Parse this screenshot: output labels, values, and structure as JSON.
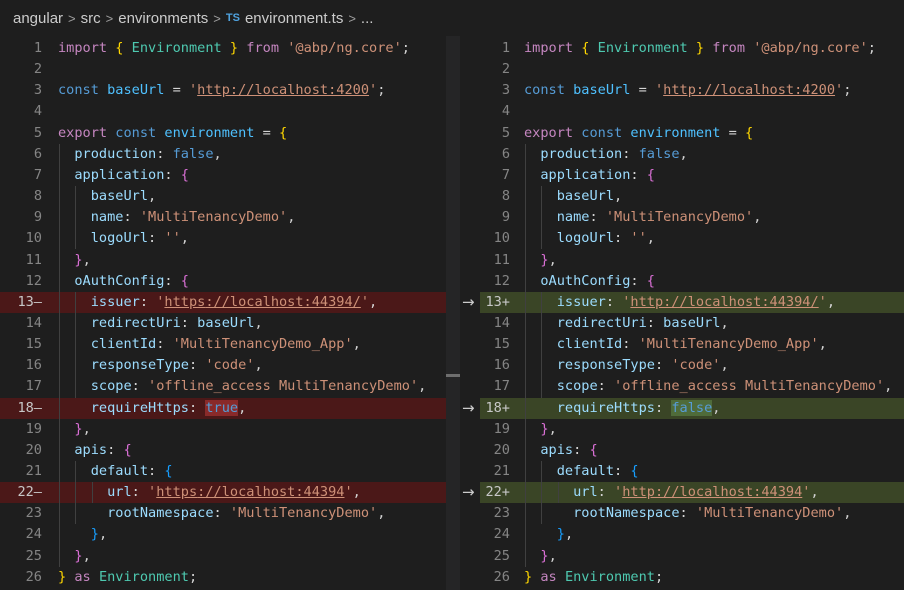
{
  "breadcrumb": {
    "items": [
      "angular",
      "src",
      "environments"
    ],
    "file_badge": "TS",
    "file": "environment.ts",
    "more": "..."
  },
  "left_lines": [
    {
      "n": "1",
      "t": [
        [
          "kb-import",
          "import"
        ],
        [
          "p",
          " "
        ],
        [
          "b1",
          "{"
        ],
        [
          "p",
          " "
        ],
        [
          "t",
          "Environment"
        ],
        [
          "p",
          " "
        ],
        [
          "b1",
          "}"
        ],
        [
          "p",
          " "
        ],
        [
          "k",
          "from"
        ],
        [
          "p",
          " "
        ],
        [
          "s",
          "'@abp/ng.core'"
        ],
        [
          "d",
          ";"
        ]
      ]
    },
    {
      "n": "2",
      "t": []
    },
    {
      "n": "3",
      "t": [
        [
          "kb",
          "const"
        ],
        [
          "d",
          " "
        ],
        [
          "v",
          "baseUrl"
        ],
        [
          "d",
          " = "
        ],
        [
          "s",
          "'"
        ],
        [
          "u",
          "http://localhost:4200"
        ],
        [
          "s",
          "'"
        ],
        [
          "d",
          ";"
        ]
      ]
    },
    {
      "n": "4",
      "t": []
    },
    {
      "n": "5",
      "t": [
        [
          "k",
          "export"
        ],
        [
          "d",
          " "
        ],
        [
          "kb",
          "const"
        ],
        [
          "d",
          " "
        ],
        [
          "v",
          "environment"
        ],
        [
          "d",
          " = "
        ],
        [
          "b1",
          "{"
        ]
      ]
    },
    {
      "n": "6",
      "t": [
        [
          "d",
          "  "
        ],
        [
          "p",
          "production"
        ],
        [
          "d",
          ": "
        ],
        [
          "kb",
          "false"
        ],
        [
          "d",
          ","
        ]
      ]
    },
    {
      "n": "7",
      "t": [
        [
          "d",
          "  "
        ],
        [
          "p",
          "application"
        ],
        [
          "d",
          ": "
        ],
        [
          "b2",
          "{"
        ]
      ]
    },
    {
      "n": "8",
      "t": [
        [
          "d",
          "    "
        ],
        [
          "p",
          "baseUrl"
        ],
        [
          "d",
          ","
        ]
      ]
    },
    {
      "n": "9",
      "t": [
        [
          "d",
          "    "
        ],
        [
          "p",
          "name"
        ],
        [
          "d",
          ": "
        ],
        [
          "s",
          "'MultiTenancyDemo'"
        ],
        [
          "d",
          ","
        ]
      ]
    },
    {
      "n": "10",
      "t": [
        [
          "d",
          "    "
        ],
        [
          "p",
          "logoUrl"
        ],
        [
          "d",
          ": "
        ],
        [
          "s",
          "''"
        ],
        [
          "d",
          ","
        ]
      ]
    },
    {
      "n": "11",
      "t": [
        [
          "d",
          "  "
        ],
        [
          "b2",
          "}"
        ],
        [
          "d",
          ","
        ]
      ]
    },
    {
      "n": "12",
      "t": [
        [
          "d",
          "  "
        ],
        [
          "p",
          "oAuthConfig"
        ],
        [
          "d",
          ": "
        ],
        [
          "b2",
          "{"
        ]
      ]
    },
    {
      "n": "13—",
      "cls": "del",
      "t": [
        [
          "d",
          "    "
        ],
        [
          "p",
          "issuer"
        ],
        [
          "d",
          ": "
        ],
        [
          "s",
          "'"
        ],
        [
          "u",
          "https"
        ],
        [
          "u",
          "://localhost:44394/"
        ],
        [
          "s",
          "'"
        ],
        [
          "d",
          ","
        ]
      ]
    },
    {
      "n": "14",
      "t": [
        [
          "d",
          "    "
        ],
        [
          "p",
          "redirectUri"
        ],
        [
          "d",
          ": "
        ],
        [
          "p",
          "baseUrl"
        ],
        [
          "d",
          ","
        ]
      ]
    },
    {
      "n": "15",
      "t": [
        [
          "d",
          "    "
        ],
        [
          "p",
          "clientId"
        ],
        [
          "d",
          ": "
        ],
        [
          "s",
          "'MultiTenancyDemo_App'"
        ],
        [
          "d",
          ","
        ]
      ]
    },
    {
      "n": "16",
      "t": [
        [
          "d",
          "    "
        ],
        [
          "p",
          "responseType"
        ],
        [
          "d",
          ": "
        ],
        [
          "s",
          "'code'"
        ],
        [
          "d",
          ","
        ]
      ]
    },
    {
      "n": "17",
      "t": [
        [
          "d",
          "    "
        ],
        [
          "p",
          "scope"
        ],
        [
          "d",
          ": "
        ],
        [
          "s",
          "'offline_access MultiTenancyDemo'"
        ],
        [
          "d",
          ","
        ]
      ]
    },
    {
      "n": "18—",
      "cls": "del",
      "t": [
        [
          "d",
          "    "
        ],
        [
          "p",
          "requireHttps"
        ],
        [
          "d",
          ": "
        ],
        [
          "kbw",
          "true"
        ],
        [
          "d",
          ","
        ]
      ]
    },
    {
      "n": "19",
      "t": [
        [
          "d",
          "  "
        ],
        [
          "b2",
          "}"
        ],
        [
          "d",
          ","
        ]
      ]
    },
    {
      "n": "20",
      "t": [
        [
          "d",
          "  "
        ],
        [
          "p",
          "apis"
        ],
        [
          "d",
          ": "
        ],
        [
          "b2",
          "{"
        ]
      ]
    },
    {
      "n": "21",
      "t": [
        [
          "d",
          "    "
        ],
        [
          "p",
          "default"
        ],
        [
          "d",
          ": "
        ],
        [
          "b3",
          "{"
        ]
      ]
    },
    {
      "n": "22—",
      "cls": "del",
      "t": [
        [
          "d",
          "      "
        ],
        [
          "p",
          "url"
        ],
        [
          "d",
          ": "
        ],
        [
          "s",
          "'"
        ],
        [
          "u",
          "https"
        ],
        [
          "u",
          "://localhost:44394"
        ],
        [
          "s",
          "'"
        ],
        [
          "d",
          ","
        ]
      ]
    },
    {
      "n": "23",
      "t": [
        [
          "d",
          "      "
        ],
        [
          "p",
          "rootNamespace"
        ],
        [
          "d",
          ": "
        ],
        [
          "s",
          "'MultiTenancyDemo'"
        ],
        [
          "d",
          ","
        ]
      ]
    },
    {
      "n": "24",
      "t": [
        [
          "d",
          "    "
        ],
        [
          "b3",
          "}"
        ],
        [
          "d",
          ","
        ]
      ]
    },
    {
      "n": "25",
      "t": [
        [
          "d",
          "  "
        ],
        [
          "b2",
          "}"
        ],
        [
          "d",
          ","
        ]
      ]
    },
    {
      "n": "26",
      "t": [
        [
          "b1",
          "}"
        ],
        [
          "d",
          " "
        ],
        [
          "k",
          "as"
        ],
        [
          "d",
          " "
        ],
        [
          "t",
          "Environment"
        ],
        [
          "d",
          ";"
        ]
      ]
    }
  ],
  "right_lines": [
    {
      "n": "1",
      "t": [
        [
          "kb-import",
          "import"
        ],
        [
          "p",
          " "
        ],
        [
          "b1",
          "{"
        ],
        [
          "p",
          " "
        ],
        [
          "t",
          "Environment"
        ],
        [
          "p",
          " "
        ],
        [
          "b1",
          "}"
        ],
        [
          "p",
          " "
        ],
        [
          "k",
          "from"
        ],
        [
          "p",
          " "
        ],
        [
          "s",
          "'@abp/ng.core'"
        ],
        [
          "d",
          ";"
        ]
      ]
    },
    {
      "n": "2",
      "t": []
    },
    {
      "n": "3",
      "t": [
        [
          "kb",
          "const"
        ],
        [
          "d",
          " "
        ],
        [
          "v",
          "baseUrl"
        ],
        [
          "d",
          " = "
        ],
        [
          "s",
          "'"
        ],
        [
          "u",
          "http://localhost:4200"
        ],
        [
          "s",
          "'"
        ],
        [
          "d",
          ";"
        ]
      ]
    },
    {
      "n": "4",
      "t": []
    },
    {
      "n": "5",
      "t": [
        [
          "k",
          "export"
        ],
        [
          "d",
          " "
        ],
        [
          "kb",
          "const"
        ],
        [
          "d",
          " "
        ],
        [
          "v",
          "environment"
        ],
        [
          "d",
          " = "
        ],
        [
          "b1",
          "{"
        ]
      ]
    },
    {
      "n": "6",
      "t": [
        [
          "d",
          "  "
        ],
        [
          "p",
          "production"
        ],
        [
          "d",
          ": "
        ],
        [
          "kb",
          "false"
        ],
        [
          "d",
          ","
        ]
      ]
    },
    {
      "n": "7",
      "t": [
        [
          "d",
          "  "
        ],
        [
          "p",
          "application"
        ],
        [
          "d",
          ": "
        ],
        [
          "b2",
          "{"
        ]
      ]
    },
    {
      "n": "8",
      "t": [
        [
          "d",
          "    "
        ],
        [
          "p",
          "baseUrl"
        ],
        [
          "d",
          ","
        ]
      ]
    },
    {
      "n": "9",
      "t": [
        [
          "d",
          "    "
        ],
        [
          "p",
          "name"
        ],
        [
          "d",
          ": "
        ],
        [
          "s",
          "'MultiTenancyDemo'"
        ],
        [
          "d",
          ","
        ]
      ]
    },
    {
      "n": "10",
      "t": [
        [
          "d",
          "    "
        ],
        [
          "p",
          "logoUrl"
        ],
        [
          "d",
          ": "
        ],
        [
          "s",
          "''"
        ],
        [
          "d",
          ","
        ]
      ]
    },
    {
      "n": "11",
      "t": [
        [
          "d",
          "  "
        ],
        [
          "b2",
          "}"
        ],
        [
          "d",
          ","
        ]
      ]
    },
    {
      "n": "12",
      "t": [
        [
          "d",
          "  "
        ],
        [
          "p",
          "oAuthConfig"
        ],
        [
          "d",
          ": "
        ],
        [
          "b2",
          "{"
        ]
      ]
    },
    {
      "n": "13+",
      "cls": "ins",
      "t": [
        [
          "d",
          "    "
        ],
        [
          "p",
          "issuer"
        ],
        [
          "d",
          ": "
        ],
        [
          "s",
          "'"
        ],
        [
          "u",
          "http://localhost:44394/"
        ],
        [
          "s",
          "'"
        ],
        [
          "d",
          ","
        ]
      ]
    },
    {
      "n": "14",
      "t": [
        [
          "d",
          "    "
        ],
        [
          "p",
          "redirectUri"
        ],
        [
          "d",
          ": "
        ],
        [
          "p",
          "baseUrl"
        ],
        [
          "d",
          ","
        ]
      ]
    },
    {
      "n": "15",
      "t": [
        [
          "d",
          "    "
        ],
        [
          "p",
          "clientId"
        ],
        [
          "d",
          ": "
        ],
        [
          "s",
          "'MultiTenancyDemo_App'"
        ],
        [
          "d",
          ","
        ]
      ]
    },
    {
      "n": "16",
      "t": [
        [
          "d",
          "    "
        ],
        [
          "p",
          "responseType"
        ],
        [
          "d",
          ": "
        ],
        [
          "s",
          "'code'"
        ],
        [
          "d",
          ","
        ]
      ]
    },
    {
      "n": "17",
      "t": [
        [
          "d",
          "    "
        ],
        [
          "p",
          "scope"
        ],
        [
          "d",
          ": "
        ],
        [
          "s",
          "'offline_access MultiTenancyDemo'"
        ],
        [
          "d",
          ","
        ]
      ]
    },
    {
      "n": "18+",
      "cls": "ins",
      "t": [
        [
          "d",
          "    "
        ],
        [
          "p",
          "requireHttps"
        ],
        [
          "d",
          ": "
        ],
        [
          "kbi",
          "false"
        ],
        [
          "d",
          ","
        ]
      ]
    },
    {
      "n": "19",
      "t": [
        [
          "d",
          "  "
        ],
        [
          "b2",
          "}"
        ],
        [
          "d",
          ","
        ]
      ]
    },
    {
      "n": "20",
      "t": [
        [
          "d",
          "  "
        ],
        [
          "p",
          "apis"
        ],
        [
          "d",
          ": "
        ],
        [
          "b2",
          "{"
        ]
      ]
    },
    {
      "n": "21",
      "t": [
        [
          "d",
          "    "
        ],
        [
          "p",
          "default"
        ],
        [
          "d",
          ": "
        ],
        [
          "b3",
          "{"
        ]
      ]
    },
    {
      "n": "22+",
      "cls": "ins",
      "t": [
        [
          "d",
          "      "
        ],
        [
          "p",
          "url"
        ],
        [
          "d",
          ": "
        ],
        [
          "s",
          "'"
        ],
        [
          "u",
          "http://localhost:44394"
        ],
        [
          "s",
          "'"
        ],
        [
          "d",
          ","
        ]
      ]
    },
    {
      "n": "23",
      "t": [
        [
          "d",
          "      "
        ],
        [
          "p",
          "rootNamespace"
        ],
        [
          "d",
          ": "
        ],
        [
          "s",
          "'MultiTenancyDemo'"
        ],
        [
          "d",
          ","
        ]
      ]
    },
    {
      "n": "24",
      "t": [
        [
          "d",
          "    "
        ],
        [
          "b3",
          "}"
        ],
        [
          "d",
          ","
        ]
      ]
    },
    {
      "n": "25",
      "t": [
        [
          "d",
          "  "
        ],
        [
          "b2",
          "}"
        ],
        [
          "d",
          ","
        ]
      ]
    },
    {
      "n": "26",
      "t": [
        [
          "b1",
          "}"
        ],
        [
          "d",
          " "
        ],
        [
          "k",
          "as"
        ],
        [
          "d",
          " "
        ],
        [
          "t",
          "Environment"
        ],
        [
          "d",
          ";"
        ]
      ]
    }
  ],
  "arrows": [
    "→",
    "→",
    "→"
  ],
  "colors": {
    "deleted_line": "#4b1818",
    "inserted_line": "#3a4526",
    "string": "#ce9178",
    "keyword": "#569cd6"
  }
}
